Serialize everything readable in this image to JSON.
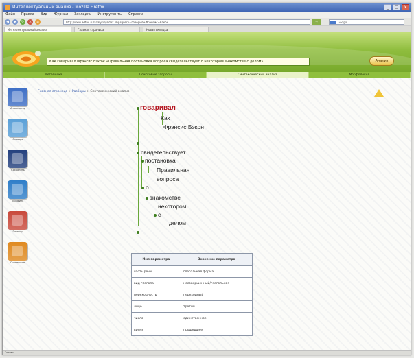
{
  "window": {
    "title": "Интеллектуальный анализ - Mozilla Firefox",
    "buttons": [
      "_",
      "□",
      "x"
    ]
  },
  "menu": [
    "Файл",
    "Правка",
    "Вид",
    "Журнал",
    "Закладки",
    "Инструменты",
    "Справка"
  ],
  "nav": {
    "address": "http://www.adtec.ru/analysis/index.php?query=говорил+Фрэнсис+Бэкон",
    "go_label": "→",
    "search_placeholder": "Google"
  },
  "browser_tabs": [
    "Интеллектуальный анализ",
    "Главная страница",
    "Новая вкладка"
  ],
  "header": {
    "query_value": "Как говаривал Фрэнсис Бэкон: «Правильная постановка вопроса свидетельствует о некотором знакомстве с делом»",
    "submit_label": "Анализ"
  },
  "mode_tabs": [
    {
      "label": "Мегаписка",
      "active": false
    },
    {
      "label": "Поисковые запросы",
      "active": false
    },
    {
      "label": "Синтаксический анализ",
      "active": true
    },
    {
      "label": "Морфология",
      "active": false
    }
  ],
  "sidebar": [
    {
      "label": "Анализатор",
      "color": "#3f6fc6",
      "icon": "book-icon"
    },
    {
      "label": "Словарь",
      "color": "#5aa0d8",
      "icon": "monitor-icon"
    },
    {
      "label": "Сохранить",
      "color": "#24407e",
      "icon": "floppy-icon"
    },
    {
      "label": "Профиль",
      "color": "#2f7ec9",
      "icon": "user-icon"
    },
    {
      "label": "Помощь",
      "color": "#c94a3c",
      "icon": "help-icon"
    },
    {
      "label": "Справочник",
      "color": "#e08a21",
      "icon": "books-icon"
    }
  ],
  "breadcrumb": {
    "parts": [
      "Главная страница",
      "Разборы",
      "Синтаксический анализ"
    ],
    "separator": " > "
  },
  "tree": {
    "root": "говаривал",
    "n_kak": "Как",
    "n_bacon": "Фрэнсис Бэкон",
    "n_svid": "свидетельствует",
    "n_post": "постановка",
    "n_prav": "Правильная",
    "n_vopr": "вопроса",
    "n_o": "о",
    "n_znak": "знакомстве",
    "n_nek": "некотором",
    "n_s": "с",
    "n_delom": "делом"
  },
  "param_table": {
    "headers": [
      "Имя параметра",
      "Значение параметра"
    ],
    "rows": [
      [
        "часть речи",
        "глагольная форма"
      ],
      [
        "вид глагола",
        "несовершенный/глагольная"
      ],
      [
        "переходность",
        "переходный"
      ],
      [
        "лицо",
        "третий"
      ],
      [
        "число",
        "единственное"
      ],
      [
        "время",
        "прошедшее"
      ]
    ]
  },
  "status": "Готово"
}
